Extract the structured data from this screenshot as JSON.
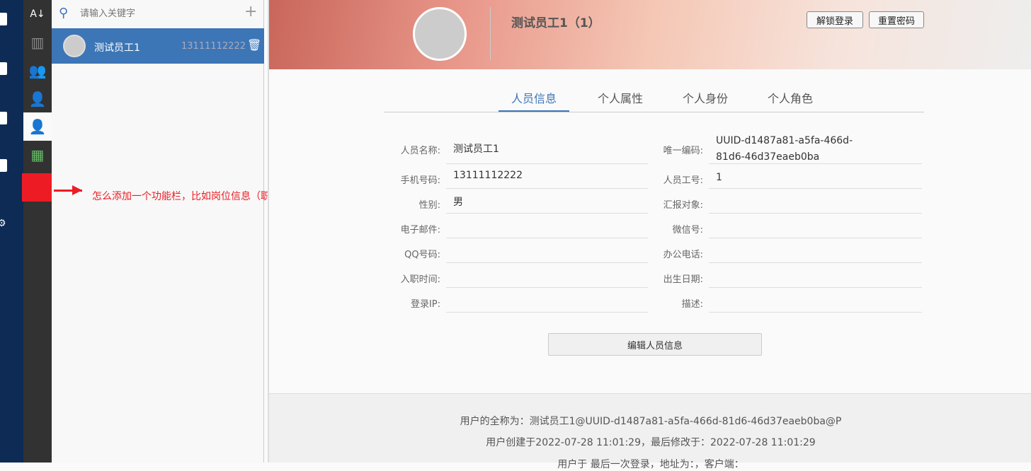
{
  "search": {
    "placeholder": "请输入关键字",
    "add": "+"
  },
  "list": [
    {
      "name": "测试员工1",
      "phone": "13111112222"
    }
  ],
  "annotation": "怎么添加一个功能栏，比如岗位信息（职位信息）",
  "header": {
    "title": "测试员工1（1）",
    "unlock": "解锁登录",
    "reset": "重置密码"
  },
  "tabs": [
    "人员信息",
    "个人属性",
    "个人身份",
    "个人角色"
  ],
  "form": {
    "left": [
      {
        "label": "人员名称:",
        "value": "测试员工1"
      },
      {
        "label": "手机号码:",
        "value": "13111112222"
      },
      {
        "label": "性别:",
        "value": "男"
      },
      {
        "label": "电子邮件:",
        "value": ""
      },
      {
        "label": "QQ号码:",
        "value": ""
      },
      {
        "label": "入职时间:",
        "value": ""
      },
      {
        "label": "登录IP:",
        "value": ""
      }
    ],
    "right": [
      {
        "label": "唯一编码:",
        "value": "UUID-d1487a81-a5fa-466d-81d6-46d37eaeb0ba"
      },
      {
        "label": "人员工号:",
        "value": "1"
      },
      {
        "label": "汇报对象:",
        "value": ""
      },
      {
        "label": "微信号:",
        "value": ""
      },
      {
        "label": "办公电话:",
        "value": ""
      },
      {
        "label": "出生日期:",
        "value": ""
      },
      {
        "label": "描述:",
        "value": ""
      }
    ],
    "edit": "编辑人员信息"
  },
  "footer": {
    "fullname": "用户的全称为：测试员工1@UUID-d1487a81-a5fa-466d-81d6-46d37eaeb0ba@P",
    "created": "用户创建于2022-07-28 11:01:29，最后修改于：2022-07-28 11:01:29",
    "login": "用户于 最后一次登录，地址为：，客户端："
  },
  "colors": {
    "accent": "#3d76b7",
    "annotation": "#ed1c24"
  }
}
